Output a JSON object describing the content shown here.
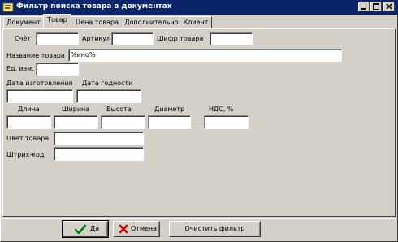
{
  "window": {
    "title": "Фильтр поиска товара в документах"
  },
  "tabs": [
    {
      "label": "Документ",
      "active": false
    },
    {
      "label": "Товар",
      "active": true
    },
    {
      "label": "Цена товара",
      "active": false
    },
    {
      "label": "Дополнительно",
      "active": false
    },
    {
      "label": "Клиент",
      "active": false
    }
  ],
  "form": {
    "account_label": "Счёт",
    "account_value": "",
    "article_label": "Артикул",
    "article_value": "",
    "code_label": "Шифр товара",
    "code_value": "",
    "name_label": "Название товара",
    "name_value": "%ино%",
    "unit_label": "Ед. изм.",
    "unit_value": "",
    "manufacture_date_label": "Дата изготовления",
    "manufacture_date_value": "",
    "expiry_date_label": "Дата годности",
    "expiry_date_value": "",
    "length_label": "Длина",
    "length_value": "",
    "width_label": "Ширина",
    "width_value": "",
    "height_label": "Высота",
    "height_value": "",
    "diameter_label": "Диаметр",
    "diameter_value": "",
    "vat_label": "НДС, %",
    "vat_value": "",
    "color_label": "Цвет товара",
    "color_value": "",
    "barcode_label": "Штрих-код",
    "barcode_value": ""
  },
  "buttons": {
    "ok": "Да",
    "cancel": "Отмена",
    "clear": "Очистить фильтр"
  },
  "icons": {
    "ok_icon": "check-icon",
    "cancel_icon": "cross-icon",
    "ok_color": "#008000",
    "cancel_color": "#cc0000",
    "titlebar_color": "#0a246a"
  }
}
